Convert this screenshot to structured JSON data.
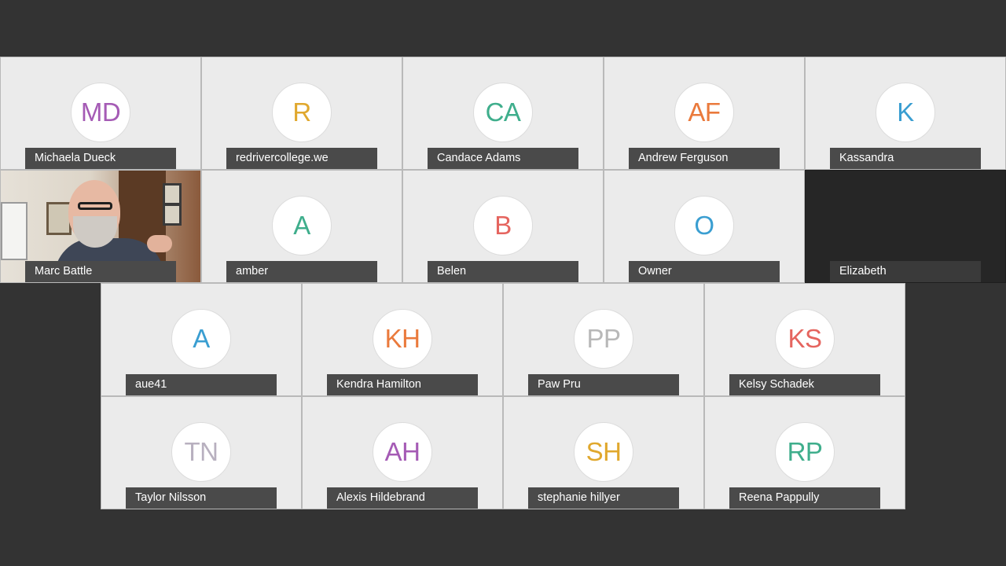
{
  "participants": [
    {
      "name": "Michaela Dueck",
      "initials": "MD",
      "color": "#a55bb5"
    },
    {
      "name": "redrivercollege.we",
      "initials": "R",
      "color": "#e0a82e"
    },
    {
      "name": "Candace Adams",
      "initials": "CA",
      "color": "#3fae8c"
    },
    {
      "name": "Andrew Ferguson",
      "initials": "AF",
      "color": "#ea7a3c"
    },
    {
      "name": "Kassandra",
      "initials": "K",
      "color": "#3a9ed1"
    },
    {
      "name": "Marc Battle",
      "initials": "",
      "color": ""
    },
    {
      "name": "amber",
      "initials": "A",
      "color": "#3fae8c"
    },
    {
      "name": "Belen",
      "initials": "B",
      "color": "#e5655f"
    },
    {
      "name": "Owner",
      "initials": "O",
      "color": "#3a9ed1"
    },
    {
      "name": "Elizabeth",
      "initials": "",
      "color": ""
    },
    {
      "name": "aue41",
      "initials": "A",
      "color": "#3a9ed1"
    },
    {
      "name": "Kendra Hamilton",
      "initials": "KH",
      "color": "#ea7a3c"
    },
    {
      "name": "Paw Pru",
      "initials": "PP",
      "color": "#b8b8b8"
    },
    {
      "name": "Kelsy Schadek",
      "initials": "KS",
      "color": "#e5655f"
    },
    {
      "name": "Taylor Nilsson",
      "initials": "TN",
      "color": "#b8b0bf"
    },
    {
      "name": "Alexis Hildebrand",
      "initials": "AH",
      "color": "#a55bb5"
    },
    {
      "name": "stephanie hillyer",
      "initials": "SH",
      "color": "#e0a82e"
    },
    {
      "name": "Reena Pappully",
      "initials": "RP",
      "color": "#3fae8c"
    }
  ]
}
